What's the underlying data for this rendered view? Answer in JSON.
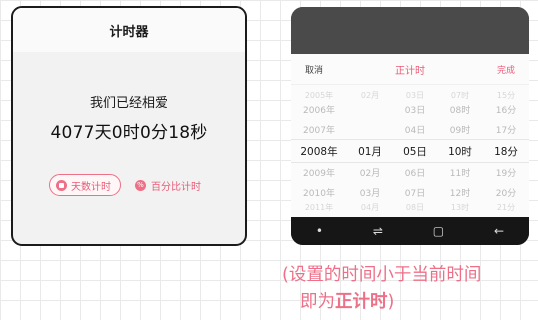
{
  "left": {
    "title": "计时器",
    "love_label": "我们已经相爱",
    "elapsed": "4077天0时0分18秒",
    "btn_days": "天数计时",
    "btn_percent": "百分比计时"
  },
  "picker": {
    "cancel": "取消",
    "title": "正计时",
    "done": "完成",
    "rows": [
      {
        "y": "2005年",
        "m": "02月",
        "d": "03日",
        "h": "07时",
        "mi": "15分",
        "state": "faint"
      },
      {
        "y": "2006年",
        "m": "",
        "d": "03日",
        "h": "08时",
        "mi": "16分",
        "state": "normal"
      },
      {
        "y": "2007年",
        "m": "",
        "d": "04日",
        "h": "09时",
        "mi": "17分",
        "state": "normal"
      },
      {
        "y": "2008年",
        "m": "01月",
        "d": "05日",
        "h": "10时",
        "mi": "18分",
        "state": "sel"
      },
      {
        "y": "2009年",
        "m": "02月",
        "d": "06日",
        "h": "11时",
        "mi": "19分",
        "state": "normal"
      },
      {
        "y": "2010年",
        "m": "03月",
        "d": "07日",
        "h": "12时",
        "mi": "20分",
        "state": "normal"
      },
      {
        "y": "2011年",
        "m": "04月",
        "d": "08日",
        "h": "13时",
        "mi": "21分",
        "state": "faint"
      }
    ]
  },
  "nav": {
    "dot": "•",
    "recent": "⇌",
    "home": "▢",
    "back": "←"
  },
  "caption": {
    "line1": "(设置的时间小于当前时间",
    "line2_prefix": "即为",
    "line2_bold": "正计时",
    "line2_suffix": ")"
  },
  "colors": {
    "accent": "#e95c76",
    "grid": "#e9e9e9"
  }
}
